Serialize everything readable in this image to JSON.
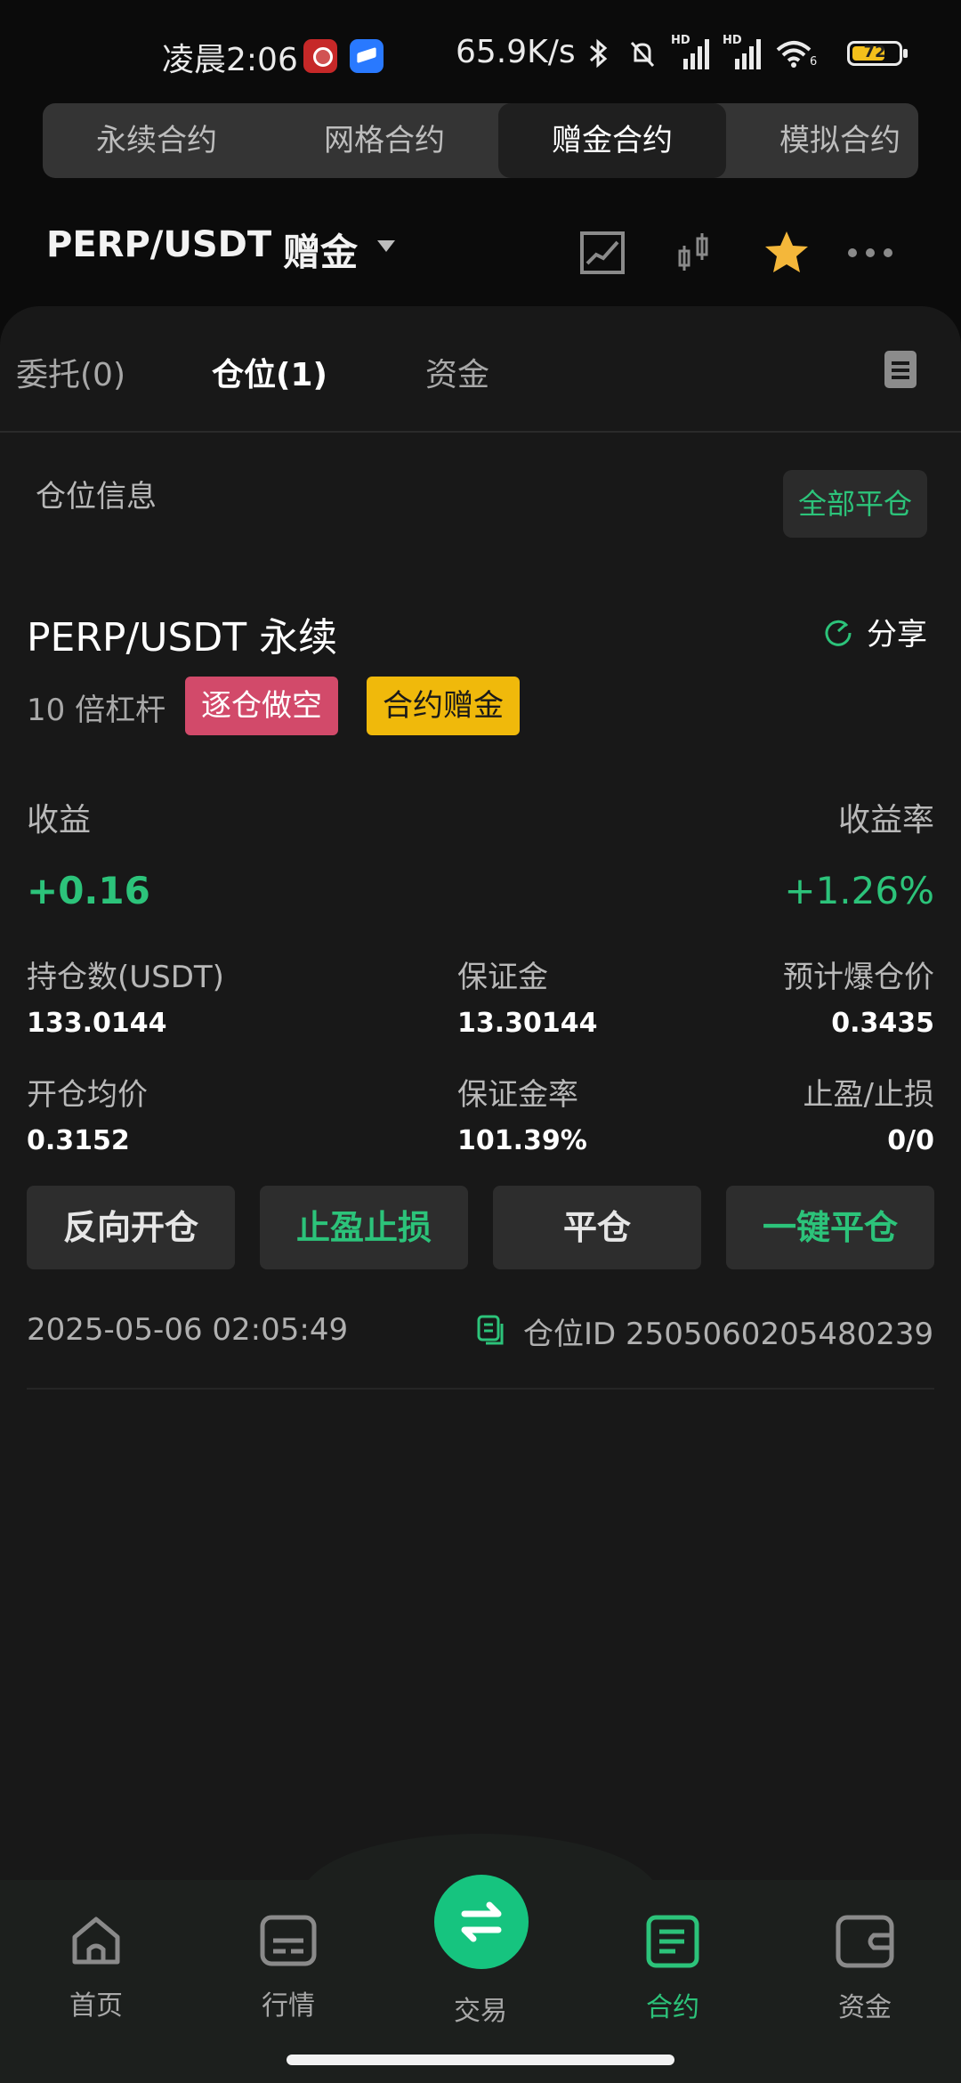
{
  "status_bar": {
    "time": "凌晨2:06",
    "network_speed": "65.9K/s",
    "signal_1_label": "HD",
    "signal_2_label": "HD",
    "wifi_label": "6",
    "battery_percent": "72"
  },
  "top_tabs": [
    {
      "label": "永续合约",
      "active": false
    },
    {
      "label": "网格合约",
      "active": false
    },
    {
      "label": "赠金合约",
      "active": true
    },
    {
      "label": "模拟合约",
      "active": false
    }
  ],
  "header": {
    "pair": "PERP/USDT",
    "tag": "赠金",
    "favorite_color": "#f4b73a"
  },
  "sub_tabs": {
    "orders": "委托(0)",
    "positions": "仓位(1)",
    "funds": "资金"
  },
  "position_section": {
    "title": "仓位信息",
    "close_all_label": "全部平仓"
  },
  "position": {
    "title": "PERP/USDT 永续",
    "share_label": "分享",
    "leverage": "10 倍杠杆",
    "badge_mode": "逐仓做空",
    "badge_bonus": "合约赠金",
    "pnl_label": "收益",
    "pnl_value": "+0.16",
    "roi_label": "收益率",
    "roi_value": "+1.26%",
    "size_label": "持仓数(USDT)",
    "size_value": "133.0144",
    "margin_label": "保证金",
    "margin_value": "13.30144",
    "liq_label": "预计爆仓价",
    "liq_value": "0.3435",
    "entry_label": "开仓均价",
    "entry_value": "0.3152",
    "margin_ratio_label": "保证金率",
    "margin_ratio_value": "101.39%",
    "tpsl_label": "止盈/止损",
    "tpsl_value": "0/0",
    "buttons": {
      "reverse": "反向开仓",
      "tpsl": "止盈止损",
      "close": "平仓",
      "quick_close": "一键平仓"
    },
    "time": "2025-05-06 02:05:49",
    "position_id": "仓位ID 2505060205480239"
  },
  "bottom_nav": {
    "home": "首页",
    "market": "行情",
    "trade": "交易",
    "contract": "合约",
    "assets": "资金"
  },
  "colors": {
    "accent_green": "#2cc37a",
    "short_red": "#d24a6a",
    "bonus_yellow": "#f0b90b"
  }
}
